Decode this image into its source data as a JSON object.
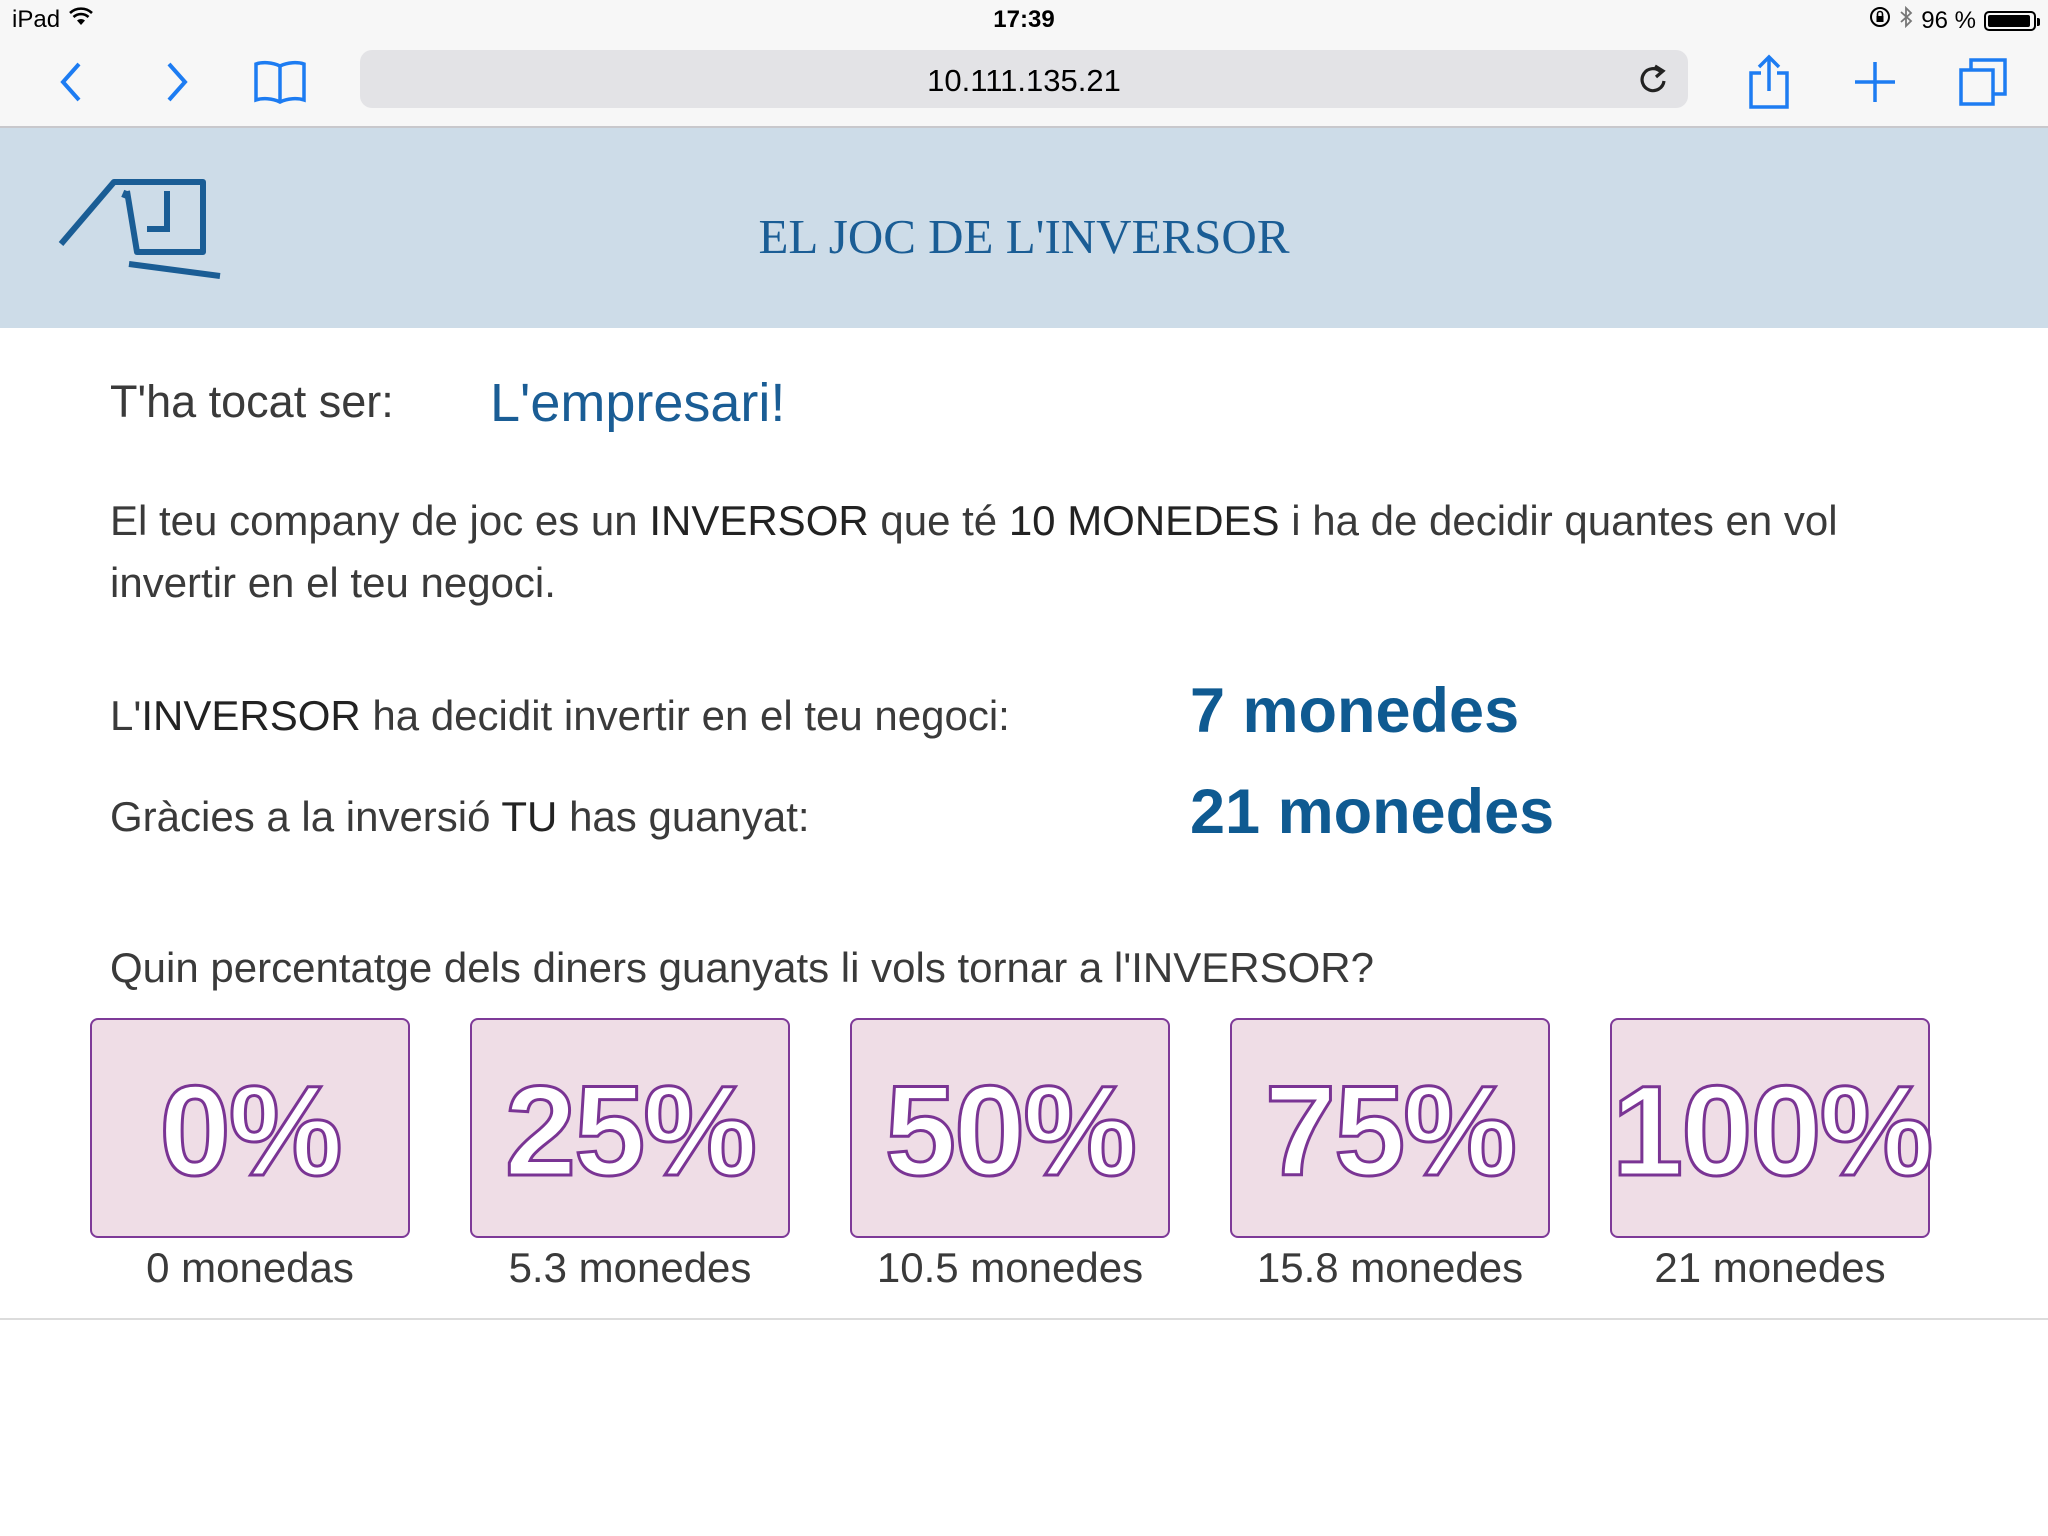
{
  "status_bar": {
    "device": "iPad",
    "time": "17:39",
    "battery_text": "96 %",
    "battery_level": 0.96
  },
  "browser": {
    "url": "10.111.135.21",
    "icons": [
      "back-icon",
      "forward-icon",
      "bookmarks-icon",
      "reload-icon",
      "share-icon",
      "new-tab-icon",
      "tabs-icon"
    ]
  },
  "header": {
    "title": "EL JOC DE L'INVERSOR"
  },
  "role": {
    "label": "T'ha tocat ser:",
    "value": "L'empresari!"
  },
  "description": {
    "part1": "El teu company de joc es un ",
    "bold1": "INVERSOR",
    "part2": " que té ",
    "bold2": "10 MONEDES",
    "part3": " i ha de decidir quantes en vol invertir en el teu negoci."
  },
  "investment": {
    "prefix": "L'",
    "bold": "INVERSOR",
    "suffix": " ha decidit invertir en el teu negoci:",
    "value": "7 monedes"
  },
  "earnings": {
    "prefix": "Gràcies a la inversió ",
    "bold": "TU",
    "suffix": " has guanyat:",
    "value": "21 monedes"
  },
  "question": "Quin percentatge dels diners guanyats li vols tornar a l'INVERSOR?",
  "options": [
    {
      "percent": "0%",
      "caption": "0 monedas"
    },
    {
      "percent": "25%",
      "caption": "5.3 monedes"
    },
    {
      "percent": "50%",
      "caption": "10.5 monedes"
    },
    {
      "percent": "75%",
      "caption": "15.8 monedes"
    },
    {
      "percent": "100%",
      "caption": "21 monedes"
    }
  ],
  "colors": {
    "accent": "#1a5d95",
    "header_bg": "#cddce8",
    "option_bg": "#efdde6",
    "option_border": "#7e3a98"
  }
}
